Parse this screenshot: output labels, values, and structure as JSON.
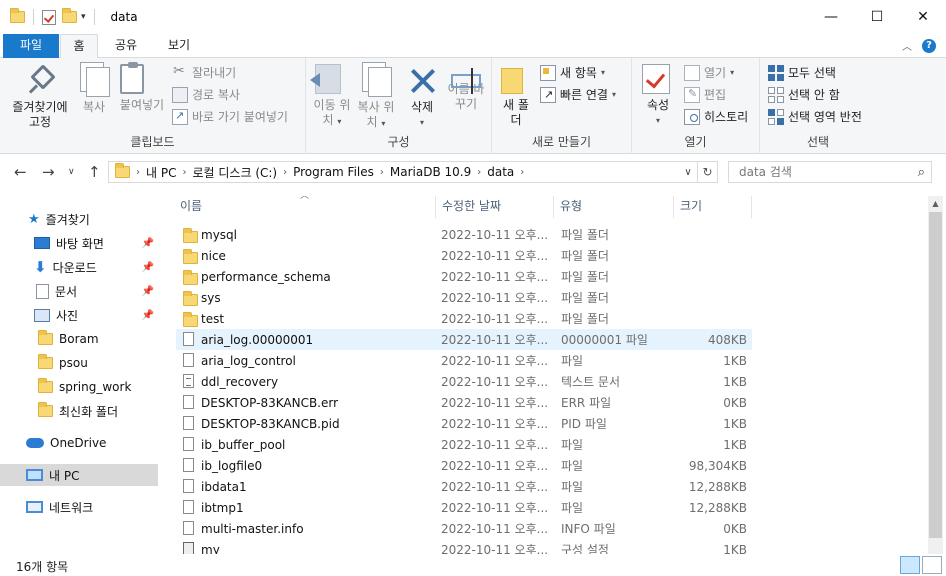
{
  "window": {
    "title": "data",
    "minimize": "—",
    "maximize": "☐",
    "close": "✕"
  },
  "ribbon_tabs": {
    "file": "파일",
    "home": "홈",
    "share": "공유",
    "view": "보기",
    "help": "?"
  },
  "clipboard": {
    "pin_label": "즐겨찾기에 고정",
    "copy_label": "복사",
    "paste_label": "붙여넣기",
    "cut_label": "잘라내기",
    "copy_path_label": "경로 복사",
    "paste_shortcut_label": "바로 가기 붙여넣기",
    "group_label": "클립보드"
  },
  "organize": {
    "move_to_label": "이동 위치",
    "copy_to_label": "복사 위치",
    "delete_label": "삭제",
    "rename_label": "이름 바꾸기",
    "group_label": "구성"
  },
  "new_group": {
    "new_folder_label": "새 폴더",
    "new_item_label": "새 항목",
    "easy_access_label": "빠른 연결",
    "group_label": "새로 만들기"
  },
  "open_group": {
    "properties_label": "속성",
    "open_label": "열기",
    "edit_label": "편집",
    "history_label": "히스토리",
    "group_label": "열기"
  },
  "select_group": {
    "select_all_label": "모두 선택",
    "select_none_label": "선택 안 함",
    "invert_label": "선택 영역 반전",
    "group_label": "선택"
  },
  "address_bar": {
    "crumbs": [
      "내 PC",
      "로컬 디스크 (C:)",
      "Program Files",
      "MariaDB 10.9",
      "data"
    ],
    "search_placeholder": "data 검색"
  },
  "nav_pane": {
    "quick_access": "즐겨찾기",
    "desktop": "바탕 화면",
    "downloads": "다운로드",
    "documents": "문서",
    "pictures": "사진",
    "boram": "Boram",
    "psou": "psou",
    "spring_work": "spring_work",
    "recent": "최신화 폴더",
    "onedrive": "OneDrive",
    "this_pc": "내 PC",
    "network": "네트워크"
  },
  "columns": {
    "name": "이름",
    "date": "수정한 날짜",
    "type": "유형",
    "size": "크기"
  },
  "files": [
    {
      "name": "mysql",
      "date": "2022-10-11 오후...",
      "type": "파일 폴더",
      "size": "",
      "kind": "folder"
    },
    {
      "name": "nice",
      "date": "2022-10-11 오후...",
      "type": "파일 폴더",
      "size": "",
      "kind": "folder"
    },
    {
      "name": "performance_schema",
      "date": "2022-10-11 오후...",
      "type": "파일 폴더",
      "size": "",
      "kind": "folder"
    },
    {
      "name": "sys",
      "date": "2022-10-11 오후...",
      "type": "파일 폴더",
      "size": "",
      "kind": "folder"
    },
    {
      "name": "test",
      "date": "2022-10-11 오후...",
      "type": "파일 폴더",
      "size": "",
      "kind": "folder"
    },
    {
      "name": "aria_log.00000001",
      "date": "2022-10-11 오후...",
      "type": "00000001 파일",
      "size": "408KB",
      "kind": "file"
    },
    {
      "name": "aria_log_control",
      "date": "2022-10-11 오후...",
      "type": "파일",
      "size": "1KB",
      "kind": "file"
    },
    {
      "name": "ddl_recovery",
      "date": "2022-10-11 오후...",
      "type": "텍스트 문서",
      "size": "1KB",
      "kind": "text"
    },
    {
      "name": "DESKTOP-83KANCB.err",
      "date": "2022-10-11 오후...",
      "type": "ERR 파일",
      "size": "0KB",
      "kind": "file"
    },
    {
      "name": "DESKTOP-83KANCB.pid",
      "date": "2022-10-11 오후...",
      "type": "PID 파일",
      "size": "1KB",
      "kind": "file"
    },
    {
      "name": "ib_buffer_pool",
      "date": "2022-10-11 오후...",
      "type": "파일",
      "size": "1KB",
      "kind": "file"
    },
    {
      "name": "ib_logfile0",
      "date": "2022-10-11 오후...",
      "type": "파일",
      "size": "98,304KB",
      "kind": "file"
    },
    {
      "name": "ibdata1",
      "date": "2022-10-11 오후...",
      "type": "파일",
      "size": "12,288KB",
      "kind": "file"
    },
    {
      "name": "ibtmp1",
      "date": "2022-10-11 오후...",
      "type": "파일",
      "size": "12,288KB",
      "kind": "file"
    },
    {
      "name": "multi-master.info",
      "date": "2022-10-11 오후...",
      "type": "INFO 파일",
      "size": "0KB",
      "kind": "file"
    },
    {
      "name": "my",
      "date": "2022-10-11 오후...",
      "type": "구성 설정",
      "size": "1KB",
      "kind": "config"
    }
  ],
  "status": {
    "item_count": "16개 항목"
  }
}
